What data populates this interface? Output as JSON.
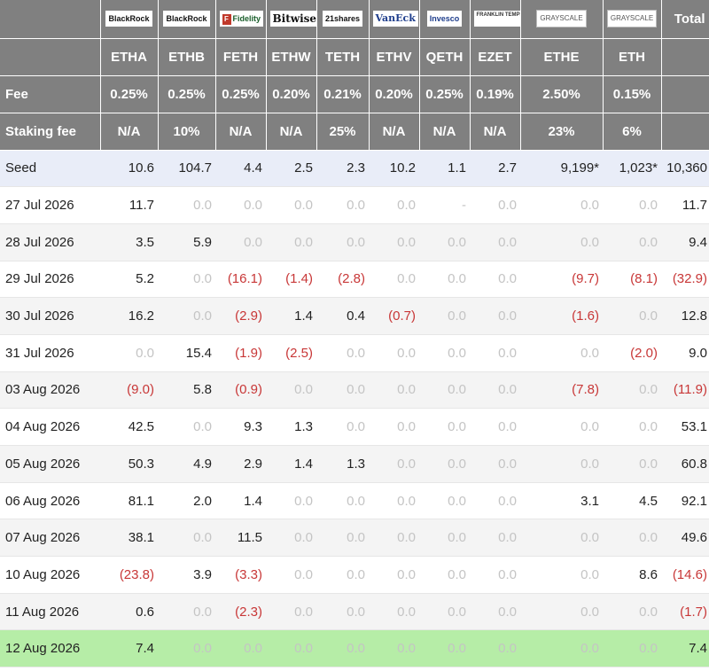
{
  "colors": {
    "header_bg": "#808080",
    "negative": "#c83737",
    "zero": "#c4c4c4",
    "seed_row_bg": "#e9edf8",
    "highlight_row_bg": "#b6eda7"
  },
  "header": {
    "issuers": [
      "BlackRock",
      "BlackRock",
      "Fidelity",
      "Bitwise",
      "21shares",
      "VanEck",
      "Invesco",
      "FRANKLIN TEMPLETON",
      "GRAYSCALE",
      "GRAYSCALE"
    ],
    "total_label": "Total",
    "tickers": [
      "ETHA",
      "ETHB",
      "FETH",
      "ETHW",
      "TETH",
      "ETHV",
      "QETH",
      "EZET",
      "ETHE",
      "ETH"
    ],
    "fee_label": "Fee",
    "fees": [
      "0.25%",
      "0.25%",
      "0.25%",
      "0.20%",
      "0.21%",
      "0.20%",
      "0.25%",
      "0.19%",
      "2.50%",
      "0.15%"
    ],
    "staking_label": "Staking fee",
    "staking": [
      "N/A",
      "10%",
      "N/A",
      "N/A",
      "25%",
      "N/A",
      "N/A",
      "N/A",
      "23%",
      "6%"
    ]
  },
  "rows": [
    {
      "label": "Seed",
      "values": [
        "10.6",
        "104.7",
        "4.4",
        "2.5",
        "2.3",
        "10.2",
        "1.1",
        "2.7",
        "9,199*",
        "1,023*"
      ],
      "total": "10,360"
    },
    {
      "label": "27 Jul 2026",
      "values": [
        "11.7",
        "0.0",
        "0.0",
        "0.0",
        "0.0",
        "0.0",
        "-",
        "0.0",
        "0.0",
        "0.0"
      ],
      "total": "11.7"
    },
    {
      "label": "28 Jul 2026",
      "values": [
        "3.5",
        "5.9",
        "0.0",
        "0.0",
        "0.0",
        "0.0",
        "0.0",
        "0.0",
        "0.0",
        "0.0"
      ],
      "total": "9.4"
    },
    {
      "label": "29 Jul 2026",
      "values": [
        "5.2",
        "0.0",
        "(16.1)",
        "(1.4)",
        "(2.8)",
        "0.0",
        "0.0",
        "0.0",
        "(9.7)",
        "(8.1)"
      ],
      "total": "(32.9)"
    },
    {
      "label": "30 Jul 2026",
      "values": [
        "16.2",
        "0.0",
        "(2.9)",
        "1.4",
        "0.4",
        "(0.7)",
        "0.0",
        "0.0",
        "(1.6)",
        "0.0"
      ],
      "total": "12.8"
    },
    {
      "label": "31 Jul 2026",
      "values": [
        "0.0",
        "15.4",
        "(1.9)",
        "(2.5)",
        "0.0",
        "0.0",
        "0.0",
        "0.0",
        "0.0",
        "(2.0)"
      ],
      "total": "9.0"
    },
    {
      "label": "03 Aug 2026",
      "values": [
        "(9.0)",
        "5.8",
        "(0.9)",
        "0.0",
        "0.0",
        "0.0",
        "0.0",
        "0.0",
        "(7.8)",
        "0.0"
      ],
      "total": "(11.9)"
    },
    {
      "label": "04 Aug 2026",
      "values": [
        "42.5",
        "0.0",
        "9.3",
        "1.3",
        "0.0",
        "0.0",
        "0.0",
        "0.0",
        "0.0",
        "0.0"
      ],
      "total": "53.1"
    },
    {
      "label": "05 Aug 2026",
      "values": [
        "50.3",
        "4.9",
        "2.9",
        "1.4",
        "1.3",
        "0.0",
        "0.0",
        "0.0",
        "0.0",
        "0.0"
      ],
      "total": "60.8"
    },
    {
      "label": "06 Aug 2026",
      "values": [
        "81.1",
        "2.0",
        "1.4",
        "0.0",
        "0.0",
        "0.0",
        "0.0",
        "0.0",
        "3.1",
        "4.5"
      ],
      "total": "92.1"
    },
    {
      "label": "07 Aug 2026",
      "values": [
        "38.1",
        "0.0",
        "11.5",
        "0.0",
        "0.0",
        "0.0",
        "0.0",
        "0.0",
        "0.0",
        "0.0"
      ],
      "total": "49.6"
    },
    {
      "label": "10 Aug 2026",
      "values": [
        "(23.8)",
        "3.9",
        "(3.3)",
        "0.0",
        "0.0",
        "0.0",
        "0.0",
        "0.0",
        "0.0",
        "8.6"
      ],
      "total": "(14.6)"
    },
    {
      "label": "11 Aug 2026",
      "values": [
        "0.6",
        "0.0",
        "(2.3)",
        "0.0",
        "0.0",
        "0.0",
        "0.0",
        "0.0",
        "0.0",
        "0.0"
      ],
      "total": "(1.7)"
    },
    {
      "label": "12 Aug 2026",
      "values": [
        "7.4",
        "0.0",
        "0.0",
        "0.0",
        "0.0",
        "0.0",
        "0.0",
        "0.0",
        "0.0",
        "0.0"
      ],
      "total": "7.4"
    }
  ]
}
